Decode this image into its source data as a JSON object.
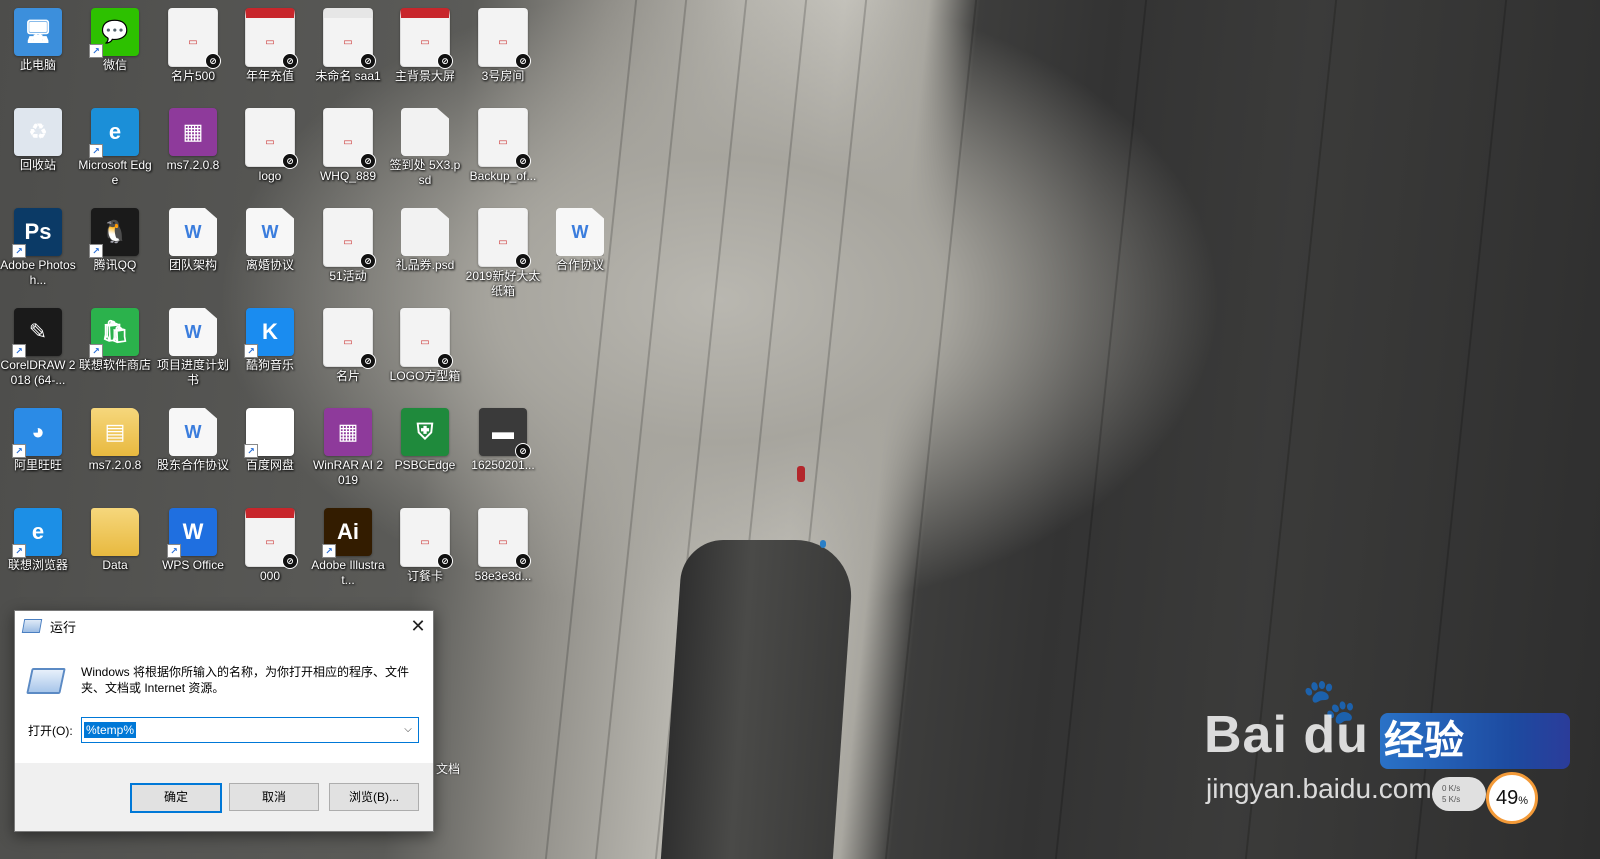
{
  "desktop": {
    "icons": [
      {
        "label": "此电脑",
        "icon": "computer-icon",
        "color": "#3c8fdc"
      },
      {
        "label": "微信",
        "icon": "wechat-icon",
        "color": "#2dc100"
      },
      {
        "label": "名片500",
        "icon": "image-thumbnail-icon",
        "color": "#f3f3f3"
      },
      {
        "label": "年年充值",
        "icon": "image-thumbnail-icon",
        "color": "#c8262b"
      },
      {
        "label": "未命名 saa1",
        "icon": "image-thumbnail-icon",
        "color": "#e6e6e6"
      },
      {
        "label": "主背景大屏",
        "icon": "image-thumbnail-icon",
        "color": "#c8262b"
      },
      {
        "label": "3号房间",
        "icon": "image-thumbnail-icon",
        "color": "#f3f3f3"
      },
      {
        "label": "回收站",
        "icon": "recycle-bin-icon",
        "color": "#dfe6ee"
      },
      {
        "label": "Microsoft Edge",
        "icon": "edge-icon",
        "color": "#1b8fd8"
      },
      {
        "label": "ms7.2.0.8",
        "icon": "winrar-icon",
        "color": "#8e3a9b"
      },
      {
        "label": "logo",
        "icon": "image-thumbnail-icon",
        "color": "#f3f3f3"
      },
      {
        "label": "WHQ_889",
        "icon": "image-thumbnail-icon",
        "color": "#f3f3f3"
      },
      {
        "label": "签到处 5X3.psd",
        "icon": "blank-file-icon",
        "color": "#f2f2f2"
      },
      {
        "label": "Backup_of...",
        "icon": "image-thumbnail-icon",
        "color": "#f3f3f3"
      },
      {
        "label": "Adobe Photosh...",
        "icon": "photoshop-icon",
        "color": "#0b3a66"
      },
      {
        "label": "腾讯QQ",
        "icon": "qq-penguin-icon",
        "color": "#1a1a1a"
      },
      {
        "label": "团队架构",
        "icon": "word-document-icon",
        "color": "#3b7ddd"
      },
      {
        "label": "离婚协议",
        "icon": "word-document-icon",
        "color": "#3b7ddd"
      },
      {
        "label": "51活动",
        "icon": "image-thumbnail-icon",
        "color": "#f3f3f3"
      },
      {
        "label": "礼品券.psd",
        "icon": "blank-file-icon",
        "color": "#f2f2f2"
      },
      {
        "label": "2019新好大太纸箱",
        "icon": "image-thumbnail-icon",
        "color": "#f3f3f3"
      },
      {
        "label": "合作协议",
        "icon": "word-document-icon",
        "color": "#3b7ddd"
      },
      {
        "label": "CorelDRAW 2018 (64-...",
        "icon": "coreldraw-icon",
        "color": "#1a1a1a"
      },
      {
        "label": "联想软件商店",
        "icon": "lenovo-store-icon",
        "color": "#2bb24c"
      },
      {
        "label": "项目进度计划书",
        "icon": "word-document-icon",
        "color": "#3b7ddd"
      },
      {
        "label": "酷狗音乐",
        "icon": "kugou-icon",
        "color": "#1a8cf0"
      },
      {
        "label": "名片",
        "icon": "image-thumbnail-icon",
        "color": "#f3f3f3"
      },
      {
        "label": "LOGO方型箱",
        "icon": "image-thumbnail-icon",
        "color": "#f3f3f3"
      },
      {
        "label": "阿里旺旺",
        "icon": "aliwangwang-icon",
        "color": "#2b8be6"
      },
      {
        "label": "ms7.2.0.8",
        "icon": "zip-folder-icon",
        "color": "#f1d27a"
      },
      {
        "label": "股东合作协议",
        "icon": "word-document-icon",
        "color": "#3b7ddd"
      },
      {
        "label": "百度网盘",
        "icon": "baidu-netdisk-icon",
        "color": "#ffffff"
      },
      {
        "label": "WinRAR AI 2019",
        "icon": "winrar-icon",
        "color": "#8e3a9b"
      },
      {
        "label": "PSBCEdge",
        "icon": "psbc-shield-icon",
        "color": "#1f8a3c"
      },
      {
        "label": "16250201...",
        "icon": "dark-thumbnail-icon",
        "color": "#3a3a3a"
      },
      {
        "label": "联想浏览器",
        "icon": "lenovo-browser-icon",
        "color": "#1c8fe6"
      },
      {
        "label": "Data",
        "icon": "folder-icon",
        "color": "#f1c75a"
      },
      {
        "label": "WPS Office",
        "icon": "wps-icon",
        "color": "#1f6fe0"
      },
      {
        "label": "000",
        "icon": "image-thumbnail-icon",
        "color": "#c8262b"
      },
      {
        "label": "Adobe Illustrat...",
        "icon": "illustrator-icon",
        "color": "#331c00"
      },
      {
        "label": "订餐卡",
        "icon": "image-thumbnail-icon",
        "color": "#f3f3f3"
      },
      {
        "label": "58e3e3d...",
        "icon": "image-thumbnail-icon",
        "color": "#f3f3f3"
      }
    ],
    "partial_label": "文档"
  },
  "run_dialog": {
    "title": "运行",
    "description": "Windows 将根据你所输入的名称，为你打开相应的程序、文件夹、文档或 Internet 资源。",
    "open_label": "打开(O):",
    "input_value": "%temp%",
    "buttons": {
      "ok": "确定",
      "cancel": "取消",
      "browse": "浏览(B)..."
    }
  },
  "watermark": {
    "brand": "Bai du",
    "jingyan": "经验",
    "url": "jingyan.baidu.com"
  },
  "widgets": {
    "net_up": "0 K/s",
    "net_down": "5 K/s",
    "memory_percent": "49",
    "percent_sign": "%"
  },
  "colors": {
    "accent": "#0078d7",
    "ring": "#f39a38"
  }
}
